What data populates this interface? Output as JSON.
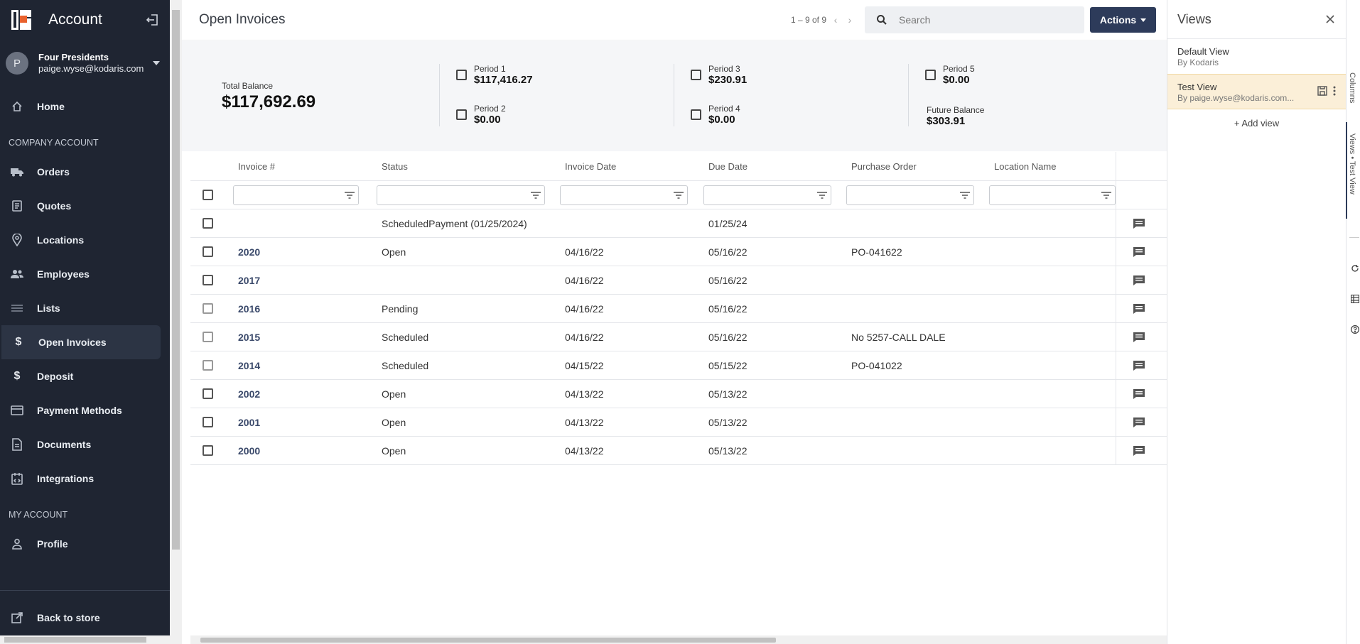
{
  "sidebar": {
    "title": "Account",
    "user": {
      "initial": "P",
      "name": "Four Presidents",
      "email": "paige.wyse@kodaris.com"
    },
    "nav_top": [
      {
        "label": "Home",
        "icon": "home-icon"
      }
    ],
    "section_company": "COMPANY ACCOUNT",
    "nav_company": [
      {
        "label": "Orders",
        "icon": "truck-icon"
      },
      {
        "label": "Quotes",
        "icon": "quote-icon"
      },
      {
        "label": "Locations",
        "icon": "location-pin-icon"
      },
      {
        "label": "Employees",
        "icon": "people-icon"
      },
      {
        "label": "Lists",
        "icon": "list-icon"
      },
      {
        "label": "Open Invoices",
        "icon": "dollar-icon",
        "active": true
      },
      {
        "label": "Deposit",
        "icon": "dollar-icon"
      },
      {
        "label": "Payment Methods",
        "icon": "card-icon"
      },
      {
        "label": "Documents",
        "icon": "document-icon"
      },
      {
        "label": "Integrations",
        "icon": "integration-icon"
      }
    ],
    "section_my": "MY ACCOUNT",
    "nav_my": [
      {
        "label": "Profile",
        "icon": "person-icon"
      }
    ],
    "footer": {
      "label": "Back to store",
      "icon": "external-link-icon"
    }
  },
  "topbar": {
    "title": "Open Invoices",
    "pager": "1 – 9 of 9",
    "search_placeholder": "Search",
    "actions_label": "Actions"
  },
  "balances": {
    "total_label": "Total Balance",
    "total_value": "$117,692.69",
    "periods": [
      {
        "label": "Period 1",
        "value": "$117,416.27"
      },
      {
        "label": "Period 2",
        "value": "$0.00"
      },
      {
        "label": "Period 3",
        "value": "$230.91"
      },
      {
        "label": "Period 4",
        "value": "$0.00"
      },
      {
        "label": "Period 5",
        "value": "$0.00"
      }
    ],
    "future_label": "Future Balance",
    "future_value": "$303.91"
  },
  "table": {
    "columns": [
      "Invoice #",
      "Status",
      "Invoice Date",
      "Due Date",
      "Purchase Order",
      "Location Name"
    ],
    "rows": [
      {
        "invoice": "",
        "status": "ScheduledPayment (01/25/2024)",
        "invoice_date": "",
        "due_date": "01/25/24",
        "po": "",
        "location": ""
      },
      {
        "invoice": "2020",
        "status": "Open",
        "invoice_date": "04/16/22",
        "due_date": "05/16/22",
        "po": "PO-041622",
        "location": ""
      },
      {
        "invoice": "2017",
        "status": "",
        "invoice_date": "04/16/22",
        "due_date": "05/16/22",
        "po": "",
        "location": ""
      },
      {
        "invoice": "2016",
        "status": "Pending",
        "invoice_date": "04/16/22",
        "due_date": "05/16/22",
        "po": "",
        "location": ""
      },
      {
        "invoice": "2015",
        "status": "Scheduled",
        "invoice_date": "04/16/22",
        "due_date": "05/16/22",
        "po": "No 5257-CALL DALE",
        "location": ""
      },
      {
        "invoice": "2014",
        "status": "Scheduled",
        "invoice_date": "04/15/22",
        "due_date": "05/15/22",
        "po": "PO-041022",
        "location": ""
      },
      {
        "invoice": "2002",
        "status": "Open",
        "invoice_date": "04/13/22",
        "due_date": "05/13/22",
        "po": "",
        "location": ""
      },
      {
        "invoice": "2001",
        "status": "Open",
        "invoice_date": "04/13/22",
        "due_date": "05/13/22",
        "po": "",
        "location": ""
      },
      {
        "invoice": "2000",
        "status": "Open",
        "invoice_date": "04/13/22",
        "due_date": "05/13/22",
        "po": "",
        "location": ""
      }
    ]
  },
  "views": {
    "title": "Views",
    "items": [
      {
        "name": "Default View",
        "by": "By Kodaris"
      },
      {
        "name": "Test View",
        "by": "By paige.wyse@kodaris.com...",
        "selected": true
      }
    ],
    "add_label": "+ Add view",
    "rail": {
      "columns": "Columns",
      "views": "Views • Test View"
    }
  },
  "colors": {
    "sidebar_bg": "#1f2532",
    "accent": "#2d3b5a",
    "selected_view_bg": "#fbefd8",
    "arrow": "#e11d1d",
    "logo": "#e8612c"
  }
}
